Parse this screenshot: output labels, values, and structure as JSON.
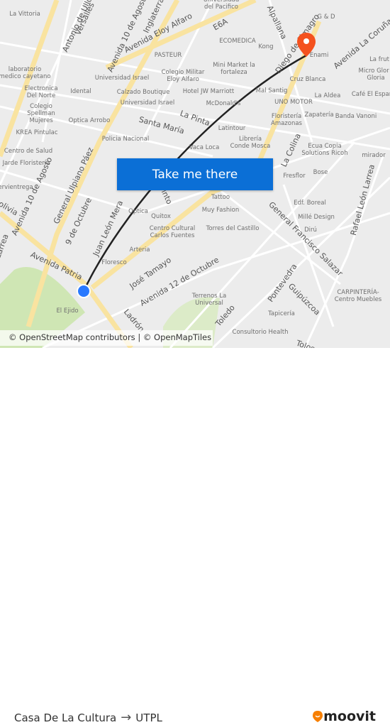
{
  "map": {
    "button_label": "Take me there",
    "attribution": "© OpenStreetMap contributors | © OpenMapTiles",
    "origin_color": "#2979ff",
    "destination_color": "#f4511e",
    "route_color": "#222222",
    "places": [
      "La Vittoria",
      "Universidad del Pacifico",
      "G & D",
      "ECOMEDICA",
      "Kong",
      "PASTEUR",
      "Enami",
      "laboratorio medico cayetano",
      "Universidad Israel",
      "Colegio Militar Eloy Alfaro",
      "Mini Market la fortaleza",
      "Cruz Blanca",
      "La frut",
      "Micro Glor - Gloria",
      "Electronica Del Norte",
      "Idental",
      "Calzado Boutique",
      "Hotel JW Marriott",
      "Mal Santig",
      "La Aldea",
      "Café El Españ",
      "Universidad Israel",
      "McDonald's",
      "UNO MOTOR",
      "Colegio Spellman Mujeres",
      "Optica Arrobo",
      "Floristería Amazonas",
      "Zapatería",
      "Banda Vanoni",
      "Latintour",
      "KREA Pintulac",
      "Policia Nacional",
      "Librería Conde Mosca",
      "Vaca Loca",
      "Ecua Copia Solutions Ricoh",
      "mirador",
      "Centro de Salud",
      "Jarde Floristería",
      "Fresflor",
      "Bose",
      "ervientrega",
      "Tattoo",
      "Edf. Boreal",
      "Optica",
      "Quitox",
      "Muy Fashion",
      "Millé Design",
      "Centro Cultural Carlos Fuentes",
      "Torres del Castillo",
      "Dirú",
      "Arteria",
      "Floresco",
      "CARPINTERÍA- Centro Muebles",
      "Terrenos La Universal",
      "Tapicería",
      "El Ejido",
      "Consultorio Health"
    ],
    "streets": [
      "Antonio de Ulloa",
      "Versalles",
      "Avenida 10 de Agosto",
      "Inglaterra",
      "Avenida Eloy Alfaro",
      "E6A",
      "Alpallana",
      "Diego de Almagro",
      "Avenida La Coruña",
      "Santa María",
      "La Pinta",
      "La Colina",
      "Avenida 10 de Agosto",
      "General Ulpiano Páez",
      "9 de Octubre",
      "Juan León Mera",
      "Bolivia",
      "Avenida Patria",
      "José Tamayo",
      "Avenida 12 de Octubre",
      "Pinto",
      "General Francisco Salazar",
      "Rafael León Larrea",
      "Pontevedra",
      "Guipúzcoa",
      "Toledo",
      "Tolosa",
      "Ladrón",
      "Larrea"
    ]
  },
  "footer": {
    "origin": "Casa De La Cultura",
    "arrow": "→",
    "destination": "UTPL",
    "brand": "moovit"
  }
}
